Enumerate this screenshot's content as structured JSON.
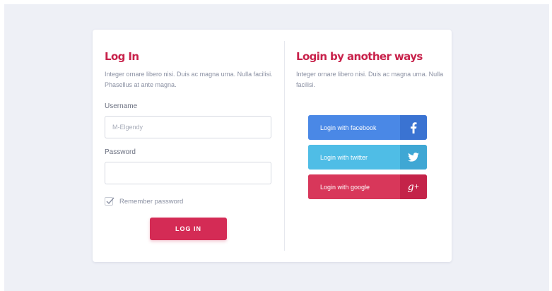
{
  "login": {
    "title": "Log In",
    "description": "Integer ornare libero nisi. Duis ac magna urna. Nulla facilisi. Phasellus at ante magna.",
    "username_label": "Username",
    "username_placeholder": "M-Elgendy",
    "password_label": "Password",
    "remember_label": "Remember password",
    "remember_checked": true,
    "login_button": "LOG IN"
  },
  "social": {
    "title": "Login by another ways",
    "description": "Integer ornare libero nisi. Duis ac magna urna. Nulla facilisi.",
    "buttons": [
      {
        "label": "Login with facebook",
        "icon": "facebook-icon",
        "color": "#4a88e6"
      },
      {
        "label": "Login with twitter",
        "icon": "twitter-icon",
        "color": "#4fbde6"
      },
      {
        "label": "Login with google",
        "icon": "google-plus-icon",
        "color": "#d8375a"
      }
    ]
  },
  "colors": {
    "accent": "#d42b55",
    "title": "#c8224b",
    "background": "#eef0f6"
  }
}
